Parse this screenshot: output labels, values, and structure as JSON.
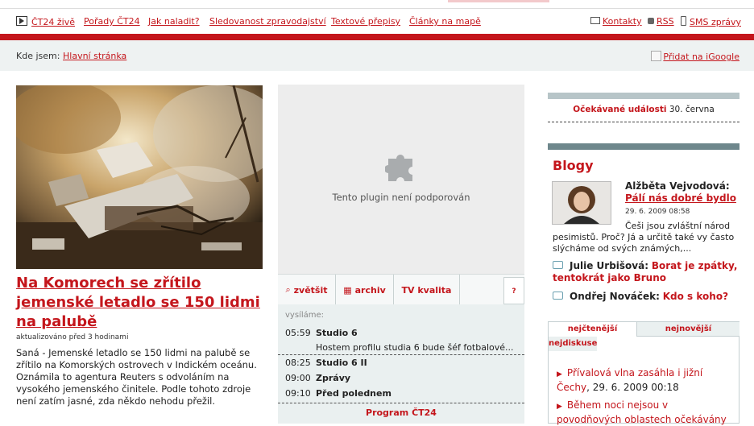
{
  "nav": {
    "items": [
      "ČT24 živě",
      "Pořady ČT24",
      "Jak naladit?",
      "Sledovanost zpravodajství",
      "Textové přepisy",
      "Články na mapě"
    ],
    "right": [
      "Kontakty",
      "RSS",
      "SMS zprávy"
    ],
    "icons": [
      "play-icon",
      "mail-icon",
      "rss-icon",
      "phone-icon"
    ]
  },
  "breadcrumb": {
    "label": "Kde jsem:",
    "link": "Hlavní stránka",
    "igoogle": "Přidat na iGoogle"
  },
  "article": {
    "headline": "Na Komorech se zřítilo jemenské letadlo se 150 lidmi na palubě",
    "updated": "aktualizováno před 3 hodinami",
    "perex": "Saná - Jemenské letadlo se 150 lidmi na palubě se zřítilo na Komorských ostrovech v Indickém oceánu. Oznámila to agentura Reuters s odvoláním na vysokého jemenského činitele. Podle tohoto zdroje není zatím jasné, zda někdo nehodu přežil."
  },
  "player": {
    "message": "Tento plugin není podporován",
    "controls": [
      "zvětšit",
      "archiv",
      "TV kvalita"
    ],
    "help": "?"
  },
  "schedule": {
    "header": "vysíláme:",
    "rows": [
      {
        "time": "05:59",
        "title": "Studio 6",
        "sub": "Hostem profilu studia 6 bude šéf fotbalové..."
      },
      {
        "time": "08:25",
        "title": "Studio 6 II",
        "sub": ""
      },
      {
        "time": "09:00",
        "title": "Zprávy",
        "sub": ""
      },
      {
        "time": "09:10",
        "title": "Před polednem",
        "sub": ""
      }
    ],
    "footer": "Program ČT24"
  },
  "events": {
    "label": "Očekávané události",
    "date": "30. června"
  },
  "blogs": {
    "title": "Blogy",
    "featured": {
      "author": "Alžběta Vejvodová:",
      "title": "Pálí nás dobré bydlo",
      "date": "29. 6. 2009 08:58",
      "text_a": "Češi jsou zvláštní národ",
      "text_b": "pesimistů. Proč? Já a určitě také vy často slýcháme od svých známých,..."
    },
    "entries": [
      {
        "author": "Julie Urbišová:",
        "title": "Borat je zpátky, tentokrát jako Bruno"
      },
      {
        "author": "Ondřej Nováček:",
        "title": "Kdo s koho?"
      }
    ]
  },
  "tabs": {
    "items": [
      "nejčtenější",
      "nejnovější",
      "nejdiskuse"
    ],
    "news": [
      {
        "title": "Přívalová vlna zasáhla i jižní Čechy",
        "date": ", 29. 6. 2009 00:18"
      },
      {
        "title": "Během noci nejsou v povodňových oblastech očekávány",
        "date": ""
      }
    ]
  },
  "colors": {
    "accent": "#c4161c",
    "bar": "#6e878c",
    "light": "#eaf0f0"
  }
}
